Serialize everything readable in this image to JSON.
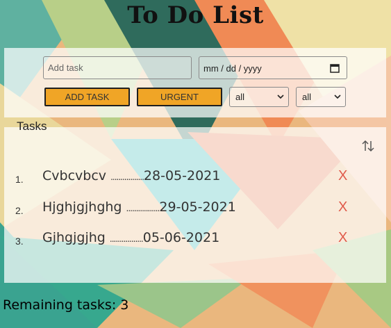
{
  "app": {
    "title": "To Do List"
  },
  "form": {
    "task_placeholder": "Add task",
    "date_placeholder": "mm / dd / yyyy",
    "add_button": "ADD TASK",
    "urgent_button": "URGENT",
    "filter_1": "all",
    "filter_2": "all"
  },
  "list": {
    "heading": "Tasks",
    "items": [
      {
        "num": "1.",
        "name": "Cvbcvbcv",
        "dots": ".................",
        "date": "28-05-2021",
        "delete": "X"
      },
      {
        "num": "2.",
        "name": "Hjghjgjhghg",
        "dots": ".................",
        "date": "29-05-2021",
        "delete": "X"
      },
      {
        "num": "3.",
        "name": "Gjhgjgjhg",
        "dots": ".................",
        "date": "05-06-2021",
        "delete": "X"
      }
    ]
  },
  "footer": {
    "remaining": "Remaining tasks: 3"
  },
  "icons": {
    "sort": "sort-arrows-icon",
    "calendar": "calendar-icon",
    "chevron": "chevron-down-icon"
  }
}
